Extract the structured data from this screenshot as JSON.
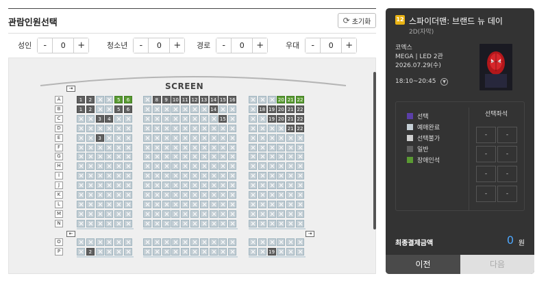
{
  "header": {
    "title": "관람인원선택",
    "reset_label": "초기화"
  },
  "counters": [
    {
      "label": "성인",
      "value": "0"
    },
    {
      "label": "청소년",
      "value": "0"
    },
    {
      "label": "경로",
      "value": "0"
    },
    {
      "label": "우대",
      "value": "0"
    }
  ],
  "stepper": {
    "minus": "-",
    "plus": "+"
  },
  "seatmap": {
    "screen_label": "SCREEN",
    "rows": [
      "A",
      "B",
      "C",
      "D",
      "E",
      "F",
      "G",
      "H",
      "I",
      "J",
      "K",
      "L",
      "M",
      "N",
      "O",
      "P"
    ],
    "open_seats": {
      "A": [
        "1",
        "2",
        "5",
        "6",
        "8",
        "9",
        "10",
        "11",
        "12",
        "13",
        "14",
        "15",
        "16",
        "20",
        "21",
        "22"
      ],
      "B": [
        "1",
        "2",
        "5",
        "6",
        "14",
        "18",
        "19",
        "20",
        "21",
        "22"
      ],
      "C": [
        "3",
        "4",
        "15",
        "19",
        "20",
        "21",
        "22"
      ],
      "D": [
        "21",
        "22"
      ],
      "E": [
        "3"
      ],
      "P": [
        "2",
        "19"
      ]
    },
    "disabled_seats": {
      "A": [
        "5",
        "6",
        "20",
        "21",
        "22"
      ]
    }
  },
  "movie": {
    "rating": "12",
    "title": "스파이더맨: 브랜드 뉴 데이",
    "format": "2D(자막)",
    "theater": "코엑스",
    "hall": "MEGA | LED 2관",
    "date": "2026.07.29(수)",
    "time": "18:10~20:45"
  },
  "legend": [
    {
      "label": "선택",
      "color": "#5b3fa8"
    },
    {
      "label": "예매완료",
      "color": "#c5cfd5"
    },
    {
      "label": "선택불가",
      "color": "#d0d0d0"
    },
    {
      "label": "일반",
      "color": "#606060"
    },
    {
      "label": "장애인석",
      "color": "#5a9a32"
    }
  ],
  "selected_seats": {
    "title": "선택좌석",
    "placeholders": [
      "-",
      "-",
      "-",
      "-",
      "-",
      "-",
      "-",
      "-"
    ]
  },
  "total": {
    "label": "최종결제금액",
    "value": "0",
    "unit": "원"
  },
  "buttons": {
    "prev": "이전",
    "next": "다음"
  }
}
